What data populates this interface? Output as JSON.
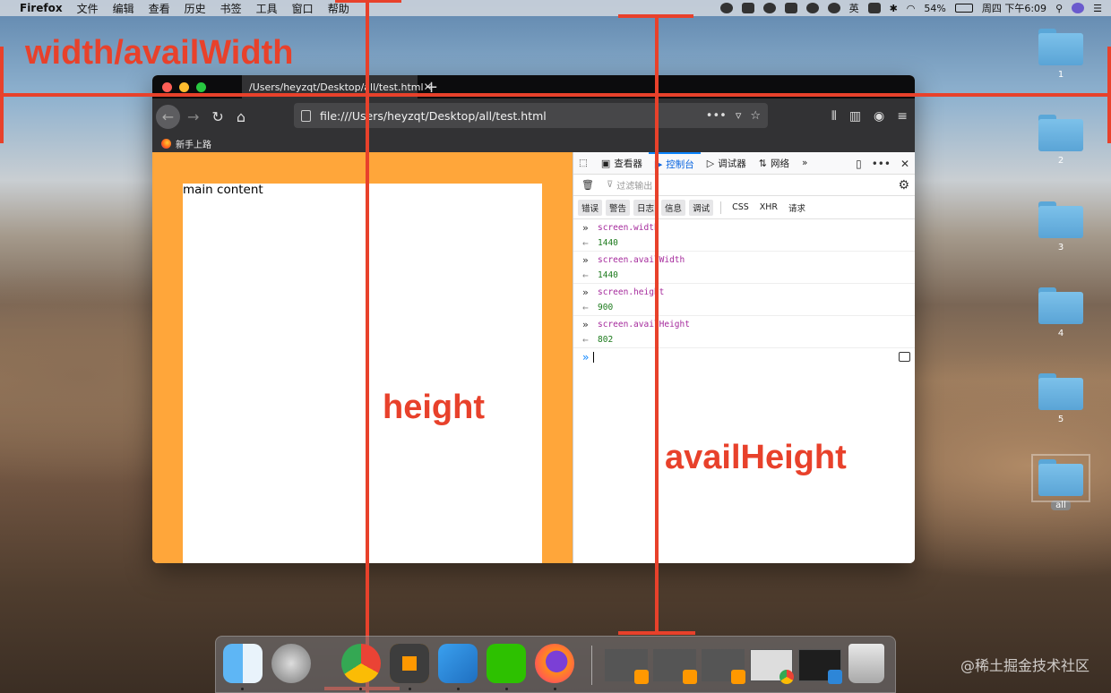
{
  "menubar": {
    "app": "Firefox",
    "items": [
      "文件",
      "编辑",
      "查看",
      "历史",
      "书签",
      "工具",
      "窗口",
      "帮助"
    ],
    "input_method": "英",
    "battery": "54%",
    "clock": "周四 下午6:09"
  },
  "desktop": {
    "folders": [
      {
        "label": "1"
      },
      {
        "label": "2"
      },
      {
        "label": "3"
      },
      {
        "label": "4"
      },
      {
        "label": "5"
      },
      {
        "label": "all"
      }
    ]
  },
  "browser": {
    "tab_title": "/Users/heyzqt/Desktop/all/test.html",
    "url": "file:///Users/heyzqt/Desktop/all/test.html",
    "bookmark": "新手上路"
  },
  "page": {
    "main_text": "main content"
  },
  "devtools": {
    "tabs": [
      "查看器",
      "控制台",
      "调试器",
      "网络"
    ],
    "active_tab": "控制台",
    "filter_placeholder": "过滤输出",
    "categories": [
      "错误",
      "警告",
      "日志",
      "信息",
      "调试",
      "CSS",
      "XHR",
      "请求"
    ],
    "log": [
      {
        "input": "screen.width",
        "output": "1440"
      },
      {
        "input": "screen.availWidth",
        "output": "1440"
      },
      {
        "input": "screen.height",
        "output": "900"
      },
      {
        "input": "screen.availHeight",
        "output": "802"
      }
    ]
  },
  "annotations": {
    "width_label": "width/availWidth",
    "height_label": "height",
    "availheight_label": "availHeight",
    "color": "#e8412b"
  },
  "watermark": "@稀土掘金技术社区"
}
